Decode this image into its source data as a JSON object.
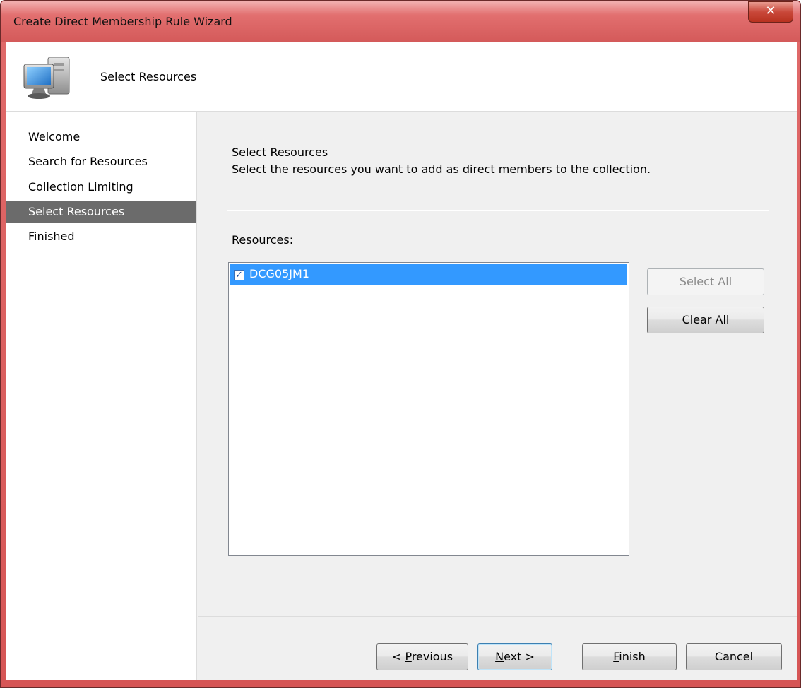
{
  "window": {
    "title": "Create Direct Membership Rule Wizard",
    "close_glyph": "✕"
  },
  "header": {
    "title": "Select Resources",
    "icon": "computer-icon"
  },
  "nav": {
    "items": [
      {
        "label": "Welcome",
        "active": false
      },
      {
        "label": "Search for Resources",
        "active": false
      },
      {
        "label": "Collection Limiting",
        "active": false
      },
      {
        "label": "Select Resources",
        "active": true
      },
      {
        "label": "Finished",
        "active": false
      }
    ]
  },
  "main": {
    "section_title": "Select Resources",
    "section_description": "Select the resources you want to add as direct members to the collection.",
    "resources_label": "Resources:",
    "resources": [
      {
        "name": "DCG05JM1",
        "checked": true,
        "selected": true
      }
    ],
    "select_all_label": "Select All",
    "clear_all_label": "Clear All"
  },
  "footer": {
    "previous_prefix": "< ",
    "previous_mnemonic": "P",
    "previous_rest": "revious",
    "next_mnemonic": "N",
    "next_rest": "ext >",
    "finish_mnemonic": "F",
    "finish_rest": "inish",
    "cancel_label": "Cancel"
  },
  "colors": {
    "title_bar": "#d65555",
    "selection": "#3399ff",
    "nav_active": "#6b6b6b"
  }
}
